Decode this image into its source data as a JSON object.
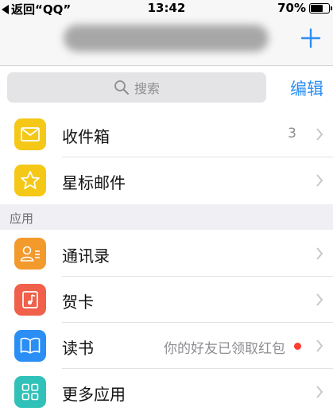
{
  "status_bar": {
    "back_app": "返回“QQ”",
    "time": "13:42",
    "battery": "70%",
    "battery_level": 0.7
  },
  "nav": {
    "add_icon": "plus-icon"
  },
  "search": {
    "placeholder": "搜索",
    "edit_label": "编辑"
  },
  "mailboxes": [
    {
      "label": "收件箱",
      "count": "3",
      "icon": "envelope-icon",
      "color": "#f5c818"
    },
    {
      "label": "星标邮件",
      "icon": "star-icon",
      "color": "#f5c818"
    }
  ],
  "apps_section": {
    "header": "应用",
    "items": [
      {
        "label": "通讯录",
        "icon": "contacts-icon",
        "color": "#f39a2c"
      },
      {
        "label": "贺卡",
        "icon": "card-icon",
        "color": "#f0604a"
      },
      {
        "label": "读书",
        "note": "你的好友已领取红包",
        "icon": "book-icon",
        "color": "#2b8ef5"
      },
      {
        "label": "更多应用",
        "icon": "grid-icon",
        "color": "#30c1b8"
      }
    ]
  }
}
